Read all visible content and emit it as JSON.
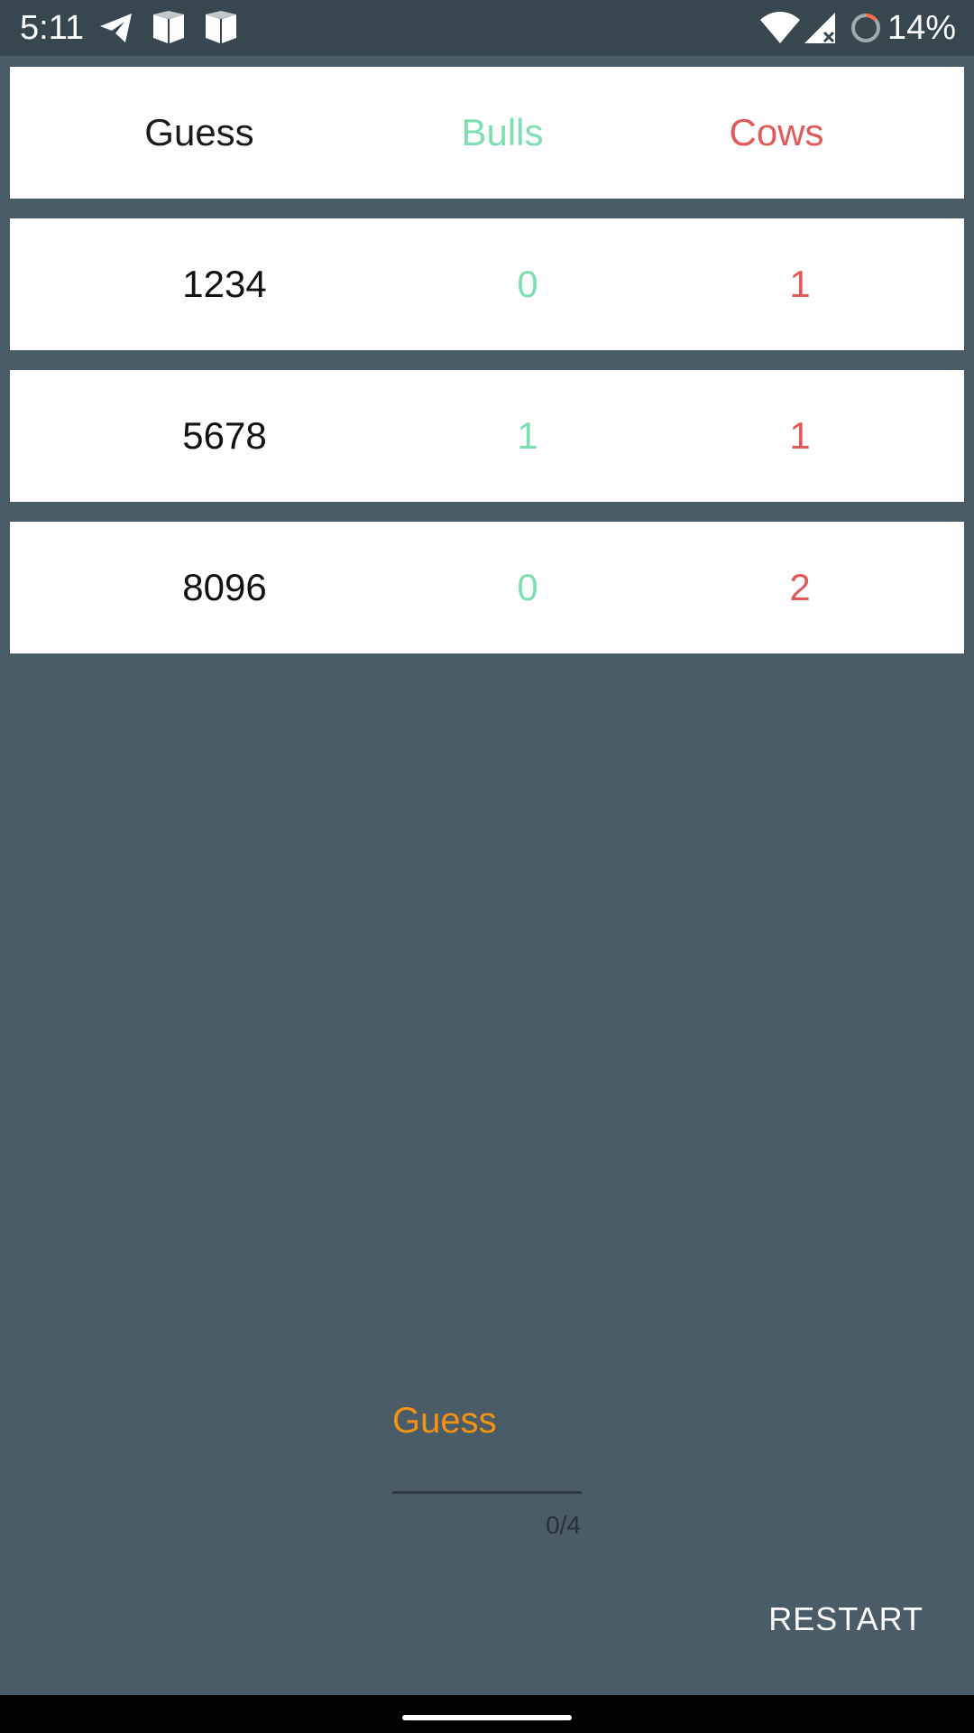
{
  "status_bar": {
    "time": "5:11",
    "battery_text": "14%",
    "icons": [
      "telegram-icon",
      "shield-icon",
      "shield-icon",
      "wifi-icon",
      "signal-icon",
      "battery-icon"
    ]
  },
  "table": {
    "headers": {
      "guess": "Guess",
      "bulls": "Bulls",
      "cows": "Cows"
    },
    "rows": [
      {
        "guess": "1234",
        "bulls": "0",
        "cows": "1"
      },
      {
        "guess": "5678",
        "bulls": "1",
        "cows": "1"
      },
      {
        "guess": "8096",
        "bulls": "0",
        "cows": "2"
      }
    ]
  },
  "input": {
    "label": "Guess",
    "value": "",
    "counter": "0/4"
  },
  "actions": {
    "restart_label": "RESTART"
  },
  "colors": {
    "background": "#4a5c68",
    "status_bar": "#37474f",
    "bulls": "#7ee0b0",
    "cows": "#e45a5a",
    "accent": "#f5930f"
  }
}
